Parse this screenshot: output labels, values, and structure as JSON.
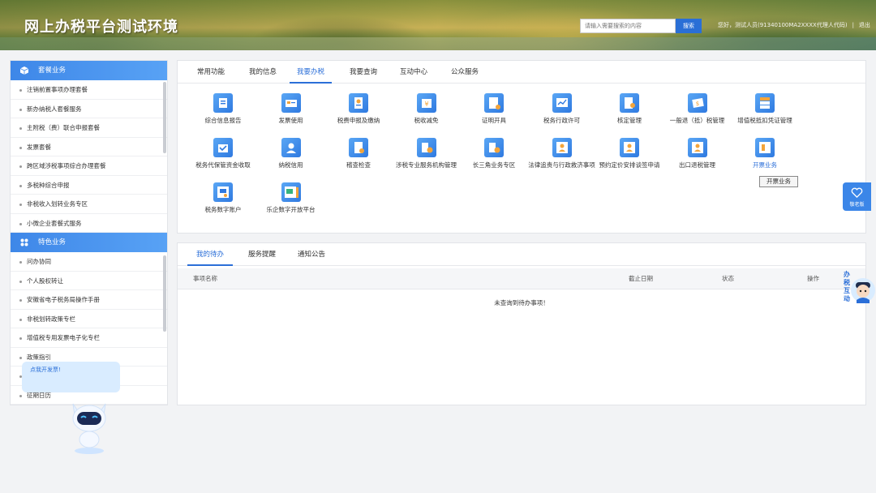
{
  "header": {
    "site_title": "网上办税平台测试环境",
    "search_placeholder": "请输入需要搜索的内容",
    "search_button": "搜索",
    "user_text": "您好，测试人员(91340100MA2XXXX代理人代码)",
    "logout": "退出"
  },
  "sidebar": {
    "section1": "套餐业务",
    "items1": [
      "注销前置事项办理套餐",
      "新办纳税人套餐服务",
      "主附税（费）联合申报套餐",
      "发票套餐",
      "跨区域涉税事项综合办理套餐",
      "多税种综合申报",
      "非税收入划转业务专区",
      "小微企业套餐式服务"
    ],
    "section2": "特色业务",
    "items2": [
      "问办协同",
      "个人股权转让",
      "安徽省电子税务局操作手册",
      "非税划转政策专栏",
      "增值税专用发票电子化专栏",
      "政策指引",
      "",
      "征期日历"
    ]
  },
  "tabs": [
    "常用功能",
    "我的信息",
    "我要办税",
    "我要查询",
    "互动中心",
    "公众服务"
  ],
  "functions": [
    {
      "label": "综合信息报告",
      "icon": "report-icon"
    },
    {
      "label": "发票使用",
      "icon": "invoice-icon"
    },
    {
      "label": "税费申报及缴纳",
      "icon": "tax-declare-icon"
    },
    {
      "label": "税收减免",
      "icon": "tax-reduction-icon"
    },
    {
      "label": "证明开具",
      "icon": "certificate-icon"
    },
    {
      "label": "税务行政许可",
      "icon": "license-icon"
    },
    {
      "label": "核定管理",
      "icon": "approval-icon"
    },
    {
      "label": "一般退（抵）税管理",
      "icon": "refund-icon"
    },
    {
      "label": "增值税抵扣凭证管理",
      "icon": "vat-voucher-icon"
    },
    {
      "label": "税务代保管资金收取",
      "icon": "custody-icon"
    },
    {
      "label": "纳税信用",
      "icon": "credit-icon"
    },
    {
      "label": "稽查检查",
      "icon": "inspection-icon"
    },
    {
      "label": "涉税专业服务机构管理",
      "icon": "agency-icon"
    },
    {
      "label": "长三角业务专区",
      "icon": "yangtze-icon"
    },
    {
      "label": "法律追责与行政救济事项",
      "icon": "legal-icon"
    },
    {
      "label": "预约定价安排谈签申请",
      "icon": "pricing-icon"
    },
    {
      "label": "出口退税管理",
      "icon": "export-refund-icon"
    },
    {
      "label": "开票业务",
      "icon": "billing-icon"
    },
    {
      "label": "税务数字账户",
      "icon": "digital-account-icon"
    },
    {
      "label": "乐企数字开放平台",
      "icon": "open-platform-icon"
    }
  ],
  "tooltip": "开票业务",
  "lower_tabs": [
    "我的待办",
    "服务提醒",
    "通知公告"
  ],
  "table": {
    "columns": [
      "事项名称",
      "截止日期",
      "状态",
      "操作"
    ],
    "empty_text": "未查询到待办事项！"
  },
  "care_button": "敬老版",
  "right_robot_text": "办税互动",
  "bubble_text": "点我开发票!",
  "colors": {
    "primary": "#2b6fd8",
    "sidebar_head": "#3e87e8"
  }
}
